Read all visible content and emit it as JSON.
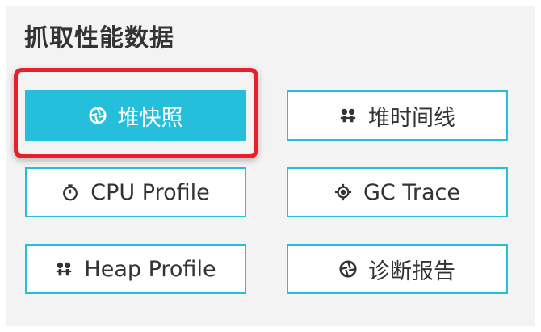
{
  "section": {
    "title": "抓取性能数据"
  },
  "buttons": [
    {
      "label": "堆快照",
      "icon": "aperture-icon",
      "active": true
    },
    {
      "label": "堆时间线",
      "icon": "people-icon",
      "active": false
    },
    {
      "label": "CPU Profile",
      "icon": "stopwatch-icon",
      "active": false
    },
    {
      "label": "GC Trace",
      "icon": "target-icon",
      "active": false
    },
    {
      "label": "Heap Profile",
      "icon": "people-icon",
      "active": false
    },
    {
      "label": "诊断报告",
      "icon": "aperture-icon",
      "active": false
    }
  ],
  "colors": {
    "accent": "#25bfdb",
    "highlight": "#e8202a",
    "panel": "#f3f3f3",
    "text": "#333333"
  }
}
